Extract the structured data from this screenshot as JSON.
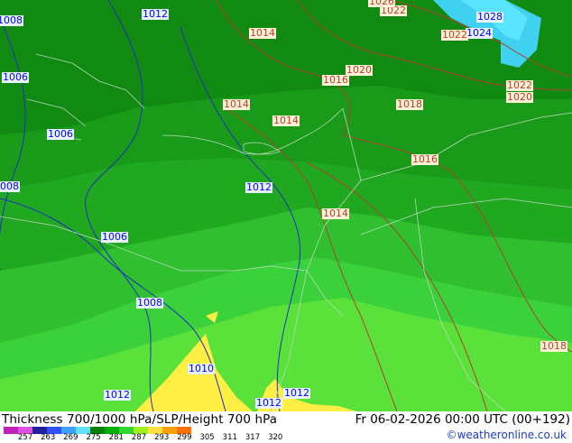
{
  "map": {
    "isobar_labels_blue": [
      "1008",
      "1012",
      "1006",
      "1006",
      "1008",
      "1012",
      "1006",
      "1008",
      "1010",
      "1012",
      "1012",
      "1012",
      "1024",
      "1028"
    ],
    "isobar_labels_red": [
      "1014",
      "1014",
      "1014",
      "1016",
      "1020",
      "1018",
      "1016",
      "1014",
      "1022",
      "1026",
      "1022",
      "1022",
      "1020",
      "1018"
    ]
  },
  "footer": {
    "title": "Thickness 700/1000 hPa/SLP/Height 700 hPa",
    "run": "Fr 06-02-2026 00:00 UTC (00+192)",
    "credit": "©weatheronline.co.uk",
    "scale_ticks": [
      "257",
      "263",
      "269",
      "275",
      "281",
      "287",
      "293",
      "299",
      "305",
      "311",
      "317",
      "320"
    ],
    "scale_colors": [
      "#c020c0",
      "#e050e0",
      "#2020a0",
      "#3050ff",
      "#40a0ff",
      "#60e0ff",
      "#008000",
      "#00b000",
      "#30d830",
      "#a0f020",
      "#ffe040",
      "#ffa000",
      "#ff7000"
    ]
  }
}
